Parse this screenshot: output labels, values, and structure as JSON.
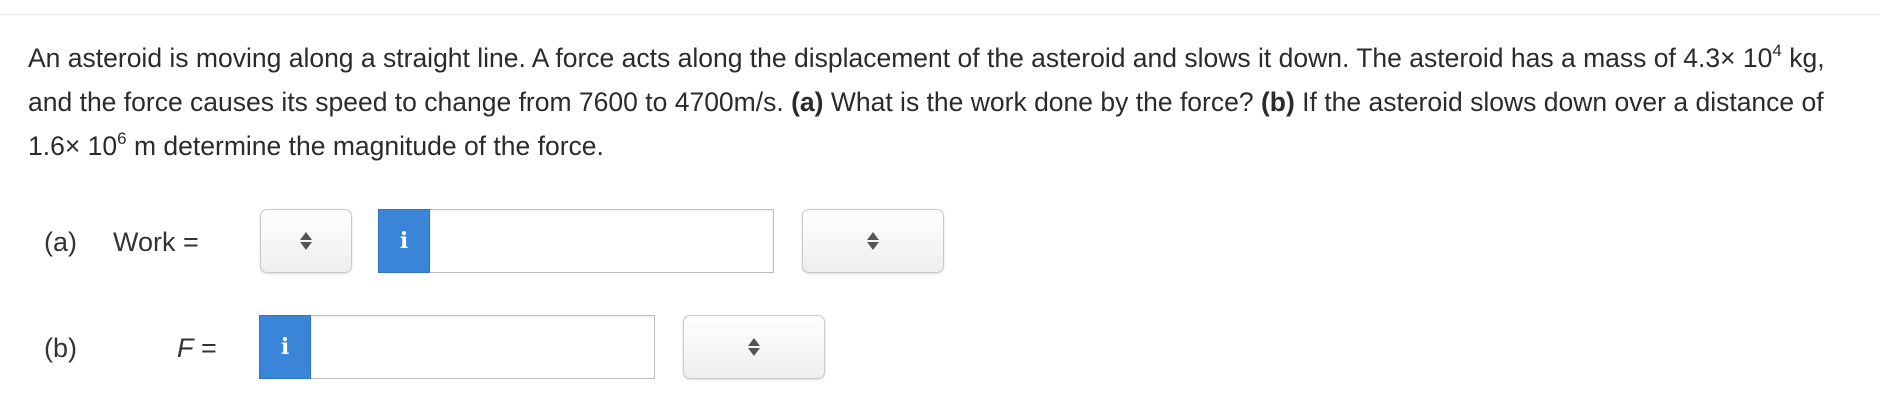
{
  "question": {
    "p1": "An asteroid is moving along a straight line. A force acts along the displacement of the asteroid and slows it down. The asteroid has a mass of 4.3× 10",
    "mass_exp": "4",
    "p2": " kg, and the force causes its speed to change from 7600 to 4700m/s. ",
    "part_a_marker": "(a)",
    "part_a_text": " What is the work done by the force? ",
    "part_b_marker": "(b)",
    "part_b_text": " If the asteroid slows down over a distance of 1.6× 10",
    "dist_exp": "6",
    "p3": " m determine the magnitude of the force."
  },
  "part_a": {
    "label": "(a)",
    "var_label": "Work =",
    "sign_select": "",
    "info_icon": "i",
    "input_value": "",
    "unit_select": ""
  },
  "part_b": {
    "label": "(b)",
    "var_symbol": "F",
    "var_eq": " =",
    "info_icon": "i",
    "input_value": "",
    "unit_select": ""
  },
  "colors": {
    "info_button": "#3a85d8",
    "text": "#2b2b2b"
  }
}
